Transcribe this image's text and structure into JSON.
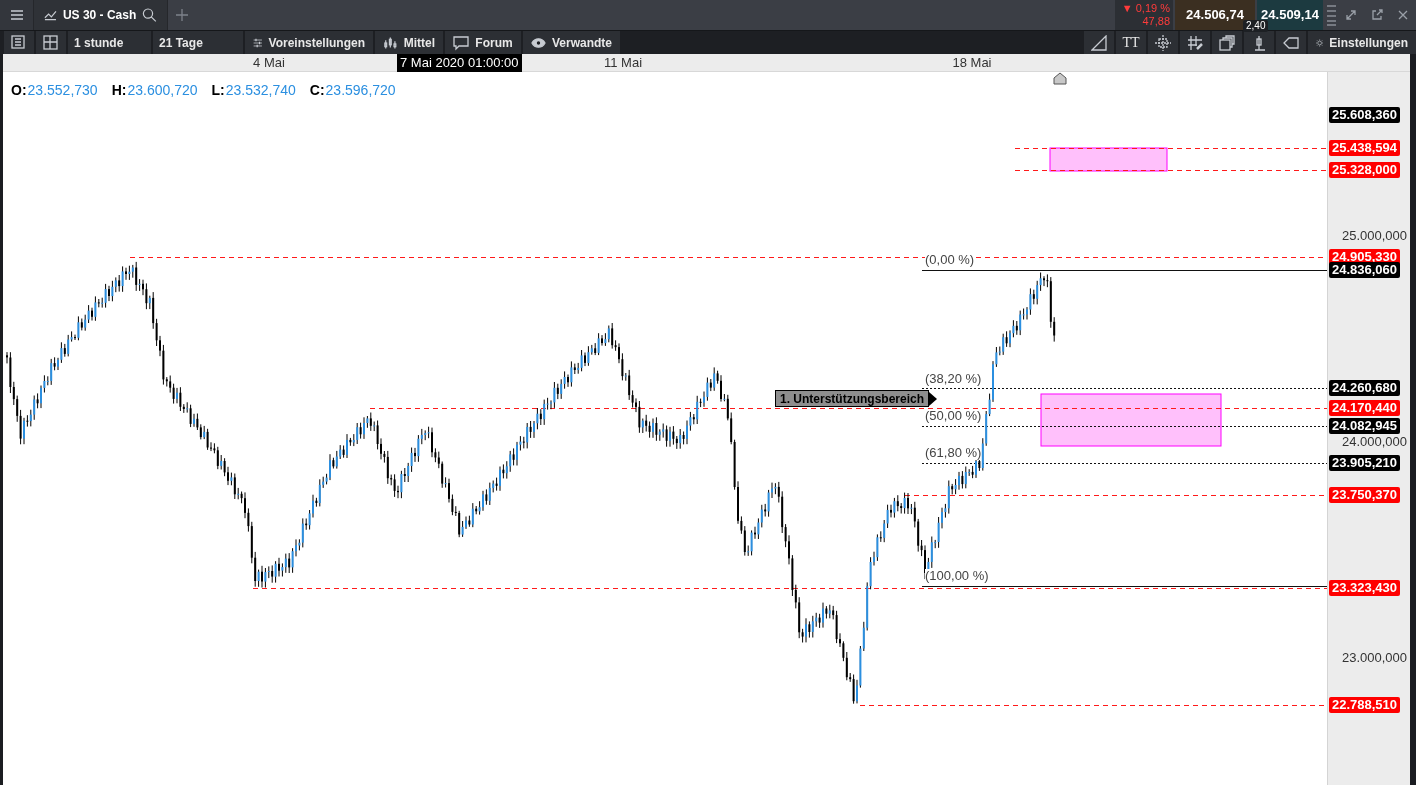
{
  "top_bar": {
    "instrument_tab": {
      "label": "US 30 - Cash"
    },
    "change": {
      "arrow": "▼",
      "percent": "0,19 %",
      "points": "47,88"
    },
    "bid": "24.506,74",
    "ask": "24.509,14",
    "spread": "2,40"
  },
  "toolbar": {
    "left": [
      {
        "kind": "list"
      },
      {
        "kind": "layout"
      },
      {
        "kind": "text",
        "label": "1 stunde"
      },
      {
        "kind": "text",
        "label": "21 Tage"
      },
      {
        "kind": "sliders",
        "label": "Voreinstellungen"
      },
      {
        "kind": "candles",
        "label": "Mittel"
      },
      {
        "kind": "chat",
        "label": "Forum"
      },
      {
        "kind": "eye",
        "label": "Verwandte"
      }
    ],
    "right": [
      {
        "kind": "trendline"
      },
      {
        "kind": "text",
        "label": "TT"
      },
      {
        "kind": "crosshair"
      },
      {
        "kind": "grid-pen"
      },
      {
        "kind": "windows"
      },
      {
        "kind": "candle"
      },
      {
        "kind": "tag"
      },
      {
        "kind": "gear",
        "label": "Einstellungen"
      }
    ]
  },
  "time_axis": {
    "labels": [
      {
        "label": "4 Mai",
        "highlighted": false
      },
      {
        "label": "7 Mai 2020 01:00:00",
        "highlighted": true
      },
      {
        "label": "11 Mai",
        "highlighted": false
      },
      {
        "label": "18 Mai",
        "highlighted": false
      }
    ]
  },
  "ohlc": [
    {
      "key": "O:",
      "value": "23.552,730"
    },
    {
      "key": "H:",
      "value": "23.600,720"
    },
    {
      "key": "L:",
      "value": "23.532,740"
    },
    {
      "key": "C:",
      "value": "23.596,720"
    }
  ],
  "price_axis": {
    "labels": [
      {
        "text": "25.608,360",
        "kind": "current"
      },
      {
        "text": "25.438,594",
        "kind": "line"
      },
      {
        "text": "25.328,000",
        "kind": "line"
      },
      {
        "text": "25.000,000",
        "kind": "tick"
      },
      {
        "text": "24.905,330",
        "kind": "line"
      },
      {
        "text": "24.836,060",
        "kind": "marker"
      },
      {
        "text": "24.260,680",
        "kind": "marker"
      },
      {
        "text": "24.170,440",
        "kind": "line"
      },
      {
        "text": "24.082,945",
        "kind": "marker"
      },
      {
        "text": "24.000,000",
        "kind": "tick"
      },
      {
        "text": "23.905,210",
        "kind": "marker"
      },
      {
        "text": "23.750,370",
        "kind": "line"
      },
      {
        "text": "23.323,430",
        "kind": "line"
      },
      {
        "text": "23.000,000",
        "kind": "tick"
      },
      {
        "text": "22.788,510",
        "kind": "line"
      }
    ]
  },
  "fib_levels": [
    {
      "label": "(0,00 %)",
      "dotted": false
    },
    {
      "label": "(38,20 %)",
      "dotted": true
    },
    {
      "label": "(50,00 %)",
      "dotted": true
    },
    {
      "label": "(61,80 %)",
      "dotted": true
    },
    {
      "label": "(100,00 %)",
      "dotted": false
    }
  ],
  "annotation": {
    "label": "1. Unterstützungsbereich"
  }
}
